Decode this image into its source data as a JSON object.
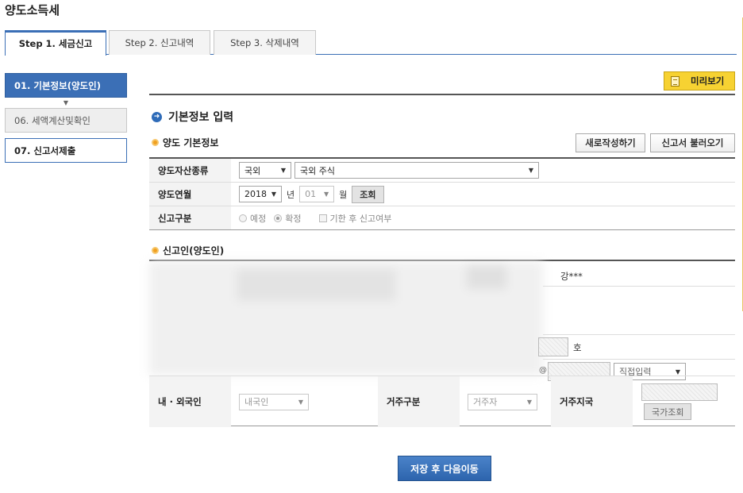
{
  "page": {
    "title": "양도소득세"
  },
  "tabs": [
    {
      "label": "Step 1. 세금신고",
      "active": true
    },
    {
      "label": "Step 2. 신고내역",
      "active": false
    },
    {
      "label": "Step 3. 삭제내역",
      "active": false
    }
  ],
  "sidebar": {
    "items": [
      {
        "label": "01. 기본정보(양도인)",
        "state": "active"
      },
      {
        "label": "06. 세액계산및확인",
        "state": "normal"
      },
      {
        "label": "07. 신고서제출",
        "state": "open"
      }
    ]
  },
  "toolbar": {
    "preview_label": "미리보기"
  },
  "section": {
    "title": "기본정보 입력"
  },
  "basic_info": {
    "title": "양도 기본정보",
    "new_button": "새로작성하기",
    "load_button": "신고서 불러오기",
    "rows": {
      "asset_type": {
        "label": "양도자산종류",
        "domestic_value": "국외",
        "stock_value": "국외 주식"
      },
      "period": {
        "label": "양도연월",
        "year_value": "2018",
        "year_unit": "년",
        "month_value": "01",
        "month_unit": "월",
        "search_button": "조회"
      },
      "report_type": {
        "label": "신고구분",
        "option_preliminary": "예정",
        "option_final": "확정",
        "option_late": "기한 후 신고여부"
      }
    }
  },
  "reporter": {
    "title": "신고인(양도인)",
    "masked_name": "강***",
    "address_suffix": "호",
    "email_at": "@",
    "email_domain_select": "직접입력",
    "nationality": {
      "label": "내 · 외국인",
      "value": "내국인"
    },
    "residency": {
      "label": "거주구분",
      "value": "거주자"
    },
    "country": {
      "label": "거주지국",
      "button": "국가조회"
    }
  },
  "footer": {
    "save_next_button": "저장 후 다음이동"
  },
  "colors": {
    "accent_blue": "#3b6fb6",
    "preview_yellow": "#f7d232",
    "bullet_orange": "#f0a020"
  }
}
